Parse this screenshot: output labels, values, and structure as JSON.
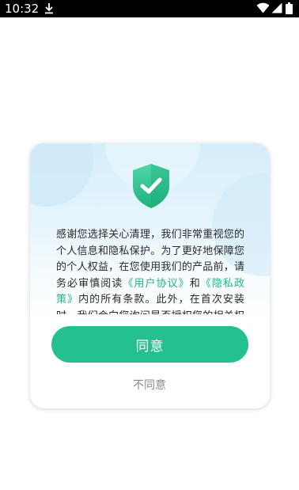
{
  "status_bar": {
    "time": "10:32",
    "icons": [
      "download-icon",
      "wifi-icon",
      "signal-icon",
      "battery-icon"
    ]
  },
  "dialog": {
    "icon": "shield-check-icon",
    "text": {
      "part1": "感谢您选择关心清理，我们非常重视您的个人信息和隐私保护。为了更好地保障您的个人权益，在您使用我们的产品前，请务必审慎阅读",
      "user_agreement_link": "《用户协议》",
      "and": "和",
      "privacy_policy_link": "《隐私政策》",
      "part2": "内的所有条款。此外，在首次安装时，我们会向您询问是否授权您的相关权限"
    },
    "agree_button": "同意",
    "disagree_button": "不同意"
  },
  "colors": {
    "accent": "#25c08f",
    "link": "#23b487",
    "status_bar": "#000000"
  }
}
